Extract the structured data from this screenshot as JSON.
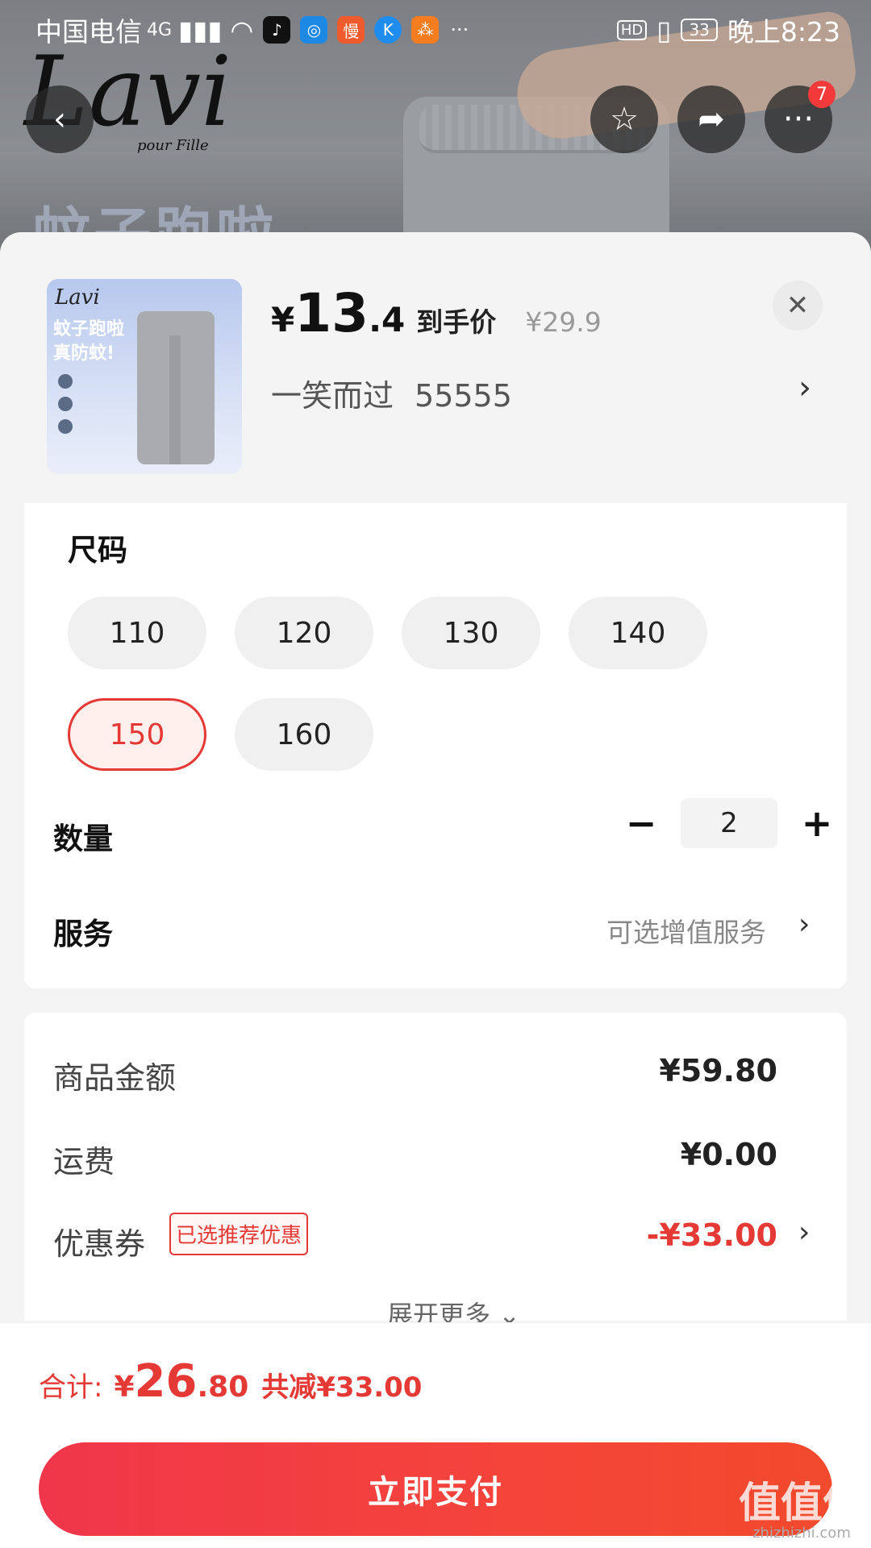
{
  "status_bar": {
    "carrier": "中国电信",
    "network": "4G",
    "hd": "HD",
    "battery": "33",
    "time": "晚上8:23",
    "more": "···"
  },
  "background": {
    "brand_script": "Lavi",
    "brand_sub": "pour Fille",
    "banner_text": "蚊子跑啦"
  },
  "header_buttons": {
    "more_badge": "7"
  },
  "product": {
    "price_yen": "¥",
    "price_int": "13",
    "price_dec": ".4",
    "price_tag": "到手价",
    "price_original": "¥29.9",
    "sku_name": "一笑而过",
    "sku_code": "55555",
    "thumb_brand": "Lavi",
    "thumb_line1": "蚊子跑啦",
    "thumb_line2": "真防蚊!"
  },
  "size": {
    "title": "尺码",
    "options": [
      "110",
      "120",
      "130",
      "140",
      "150",
      "160"
    ],
    "selected": "150"
  },
  "quantity": {
    "title": "数量",
    "minus": "−",
    "value": "2",
    "plus": "+"
  },
  "service": {
    "title": "服务",
    "hint": "可选增值服务"
  },
  "summary": {
    "goods_label": "商品金额",
    "goods_value": "¥59.80",
    "shipping_label": "运费",
    "shipping_value": "¥0.00",
    "coupon_label": "优惠券",
    "coupon_tag": "已选推荐优惠",
    "coupon_value": "-¥33.00",
    "expand_more": "展开更多"
  },
  "footer": {
    "total_label": "合计:",
    "total_yen": "¥",
    "total_int": "26",
    "total_dec": ".80",
    "total_saved": "共减¥33.00",
    "pay_button": "立即支付"
  },
  "watermark": {
    "big": "值值值",
    "small": "zhizhizhi.com"
  },
  "colors": {
    "accent": "#e53935",
    "pay_button": "#f23d3d"
  }
}
